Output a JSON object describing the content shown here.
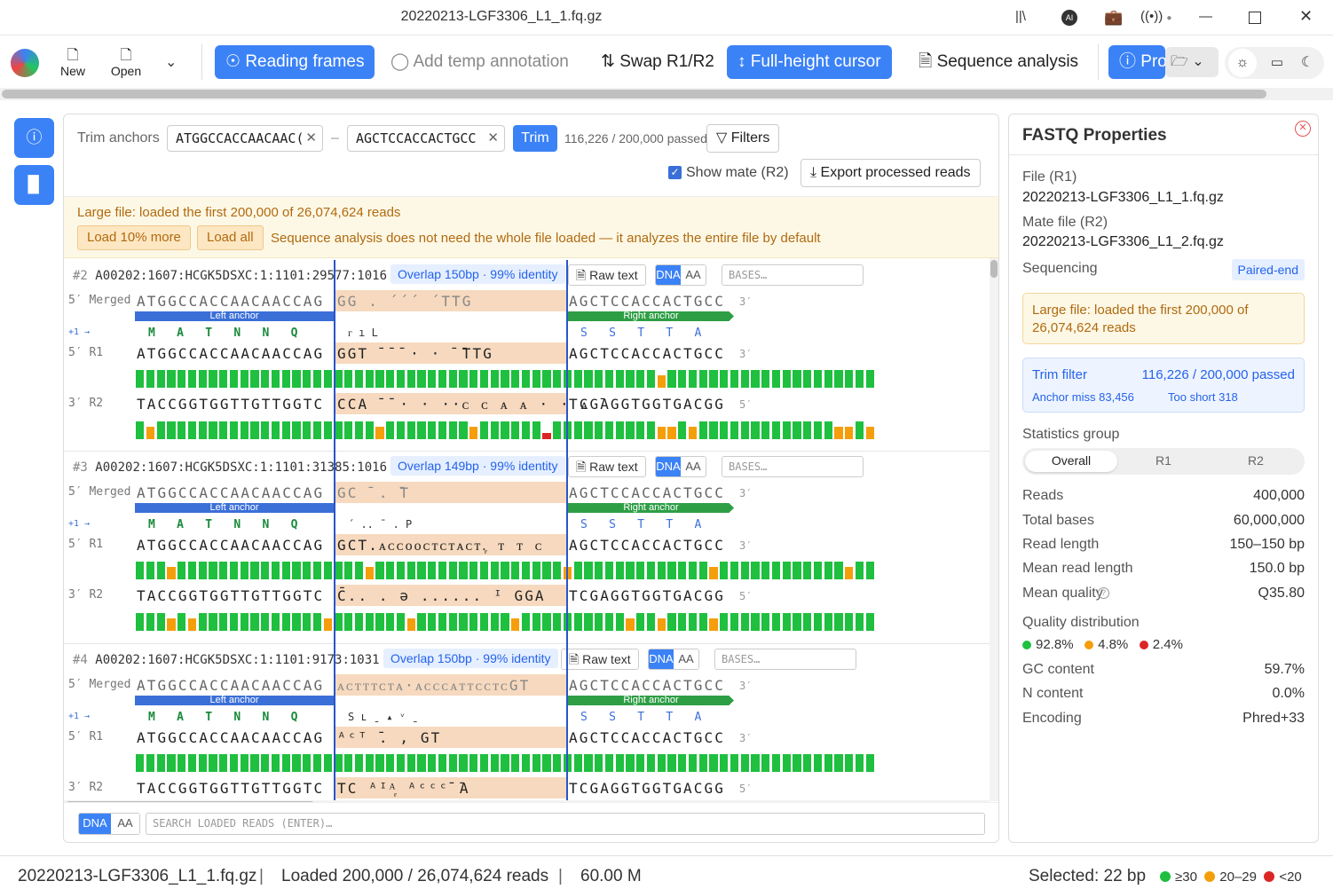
{
  "window": {
    "title": "20220213-LGF3306_L1_1.fq.gz"
  },
  "toolbar": {
    "new": "New",
    "open": "Open",
    "reading_frames": "Reading frames",
    "add_temp_annotation": "Add temp annotation",
    "swap": "Swap R1/R2",
    "full_height_cursor": "Full-height cursor",
    "sequence_analysis": "Sequence analysis",
    "pro": "Pro"
  },
  "trim": {
    "label": "Trim anchors",
    "left_anchor": "ATGGCCACCAACAAC(",
    "dash": "–",
    "right_anchor": "AGCTCCACCACTGCC",
    "trim_button": "Trim",
    "passed": "116,226 / 200,000 passed",
    "filters": "Filters",
    "show_mate": "Show mate (R2)",
    "export": "Export processed reads"
  },
  "banner": {
    "message": "Large file: loaded the first 200,000 of 26,074,624 reads",
    "load_more": "Load 10% more",
    "load_all": "Load all",
    "note": "Sequence analysis does not need the whole file loaded — it analyzes the entire file by default"
  },
  "labels": {
    "merged": "5′ Merged",
    "r1": "5′ R1",
    "r2": "3′ R2",
    "frame": "+1 →",
    "end3": "3′",
    "end5": "5′",
    "left_anchor": "Left anchor",
    "right_anchor": "Right anchor",
    "raw_text": "Raw text",
    "dna": "DNA",
    "aa": "AA",
    "bases_placeholder": "BASES…"
  },
  "reads": [
    {
      "num": "#2",
      "id": "A00202:1607:HCGK5DSXC:1:1101:29577:1016",
      "overlap": "Overlap 150bp · 99% identity",
      "merged_left": "ATGGCCACCAACAACCAG",
      "merged_mid": "GG . ´´´ ´TTG",
      "merged_right": "AGCTCCACCACTGCC",
      "aa_left": "MATNNQ",
      "aa_mid": "ᴦ                           ı  L",
      "aa_right": "SSTTA",
      "r1_left": "ATGGCCACCAACAACCAG",
      "r1_mid": "GGT ̄ ̄ ̄  · ·   ̄ ̄TTG",
      "r1_right": "AGCTCCACCACTGCC",
      "r2_left": "TACCGGTGGTTGTTGGTC",
      "r2_mid": "CCA ̄ ̄ · · ··ᴄ ᴄ ᴀ ᴀ ·  · ᴀ ̄",
      "r2_right": "TCGAGGTGGTGACGG",
      "q1": "ggggggggggggggggggggggggggggggggggggggggggggggggggogggggggggggggggggggggggggggggg",
      "q2": "gogggggggggggggggggggggoggggggggoggggggrggggggggggoogogggggggggggggoogogggogggggggg"
    },
    {
      "num": "#3",
      "id": "A00202:1607:HCGK5DSXC:1:1101:31385:1016",
      "overlap": "Overlap 149bp · 99% identity",
      "merged_left": "ATGGCCACCAACAACCAG",
      "merged_mid": "GC ̄ .                          ̄T",
      "merged_right": "AGCTCCACCACTGCC",
      "aa_left": "MATNNQ",
      "aa_mid": "´          ..       ¯      .   P",
      "aa_right": "SSTTA",
      "r1_left": "ATGGCCACCAACAACCAG",
      "r1_mid": "GCT.ᴀᴄᴄᴏᴏᴄᴛᴄᴛᴀᴄᴛ.᷊ ᴛ ᴛ ᴄ",
      "r1_right": "AGCTCCACCACTGCC",
      "r2_left": "TACCGGTGGTTGTTGGTC",
      "r2_mid": "C̄.. .     ǝ      ...... ᴵ GGA",
      "r2_right": "TCGAGGTGGTGACGG",
      "q1": "gggoggggggggggggggggggoggggggggggggggggggogggggggggggggoggggggggggggogggggggggggggg",
      "q2": "gggogoggggggggggggogggggggogggggggggoggggggggggoggoggggogggggggggggggggggggggggggg"
    },
    {
      "num": "#4",
      "id": "A00202:1607:HCGK5DSXC:1:1101:9173:1031",
      "overlap": "Overlap 150bp · 99% identity",
      "merged_left": "ATGGCCACCAACAACCAG",
      "merged_mid": "ᴀᴄᴛᴛᴛᴄᴛᴀ·ᴀᴄᴄᴄᴀᴛᴛᴄᴄᴛᴄGT",
      "merged_right": "AGCTCCACCACTGCC",
      "aa_left": "MATNNQ",
      "aa_mid": "S    ʟ          ˍ   ▴  ᵛ  ˍ",
      "aa_right": "SSTTA",
      "r1_left": "ATGGCCACCAACAACCAG",
      "r1_mid": "ᴬᶜᵀ ̄.                   , GT",
      "r1_right": "AGCTCCACCACTGCC",
      "r2_left": "TACCGGTGGTTGTTGGTC",
      "r2_mid": "TC    ᴬᴵᴬ᷊          ᴬᶜᶜᶜ̄  ̄A",
      "r2_right": "TCGAGGTGGTGACGG",
      "q1": "ggggggggggggggggggggggggggggggggggggggggggggggggggggggggggggggggggggggggggggggggggg",
      "q2": ""
    }
  ],
  "search": {
    "dna": "DNA",
    "aa": "AA",
    "placeholder": "SEARCH LOADED READS (ENTER)…"
  },
  "properties": {
    "title": "FASTQ Properties",
    "file_label": "File (R1)",
    "file": "20220213-LGF3306_L1_1.fq.gz",
    "mate_label": "Mate file (R2)",
    "mate": "20220213-LGF3306_L1_2.fq.gz",
    "sequencing_label": "Sequencing",
    "sequencing": "Paired-end",
    "large_file": "Large file: loaded the first 200,000 of 26,074,624 reads",
    "trim_filter_label": "Trim filter",
    "trim_filter": "116,226 / 200,000 passed",
    "anchor_miss": "Anchor miss 83,456",
    "too_short": "Too short 318",
    "stats_group_label": "Statistics group",
    "tabs": [
      "Overall",
      "R1",
      "R2"
    ],
    "stats": [
      {
        "label": "Reads",
        "value": "400,000"
      },
      {
        "label": "Total bases",
        "value": "60,000,000"
      },
      {
        "label": "Read length",
        "value": "150–150 bp"
      },
      {
        "label": "Mean read length",
        "value": "150.0 bp"
      },
      {
        "label": "Mean quality",
        "value": "Q35.80"
      }
    ],
    "quality_distribution_label": "Quality distribution",
    "quality_distribution": [
      {
        "value": "92.8%",
        "color": "#1fbf3f"
      },
      {
        "value": "4.8%",
        "color": "#f59e0b"
      },
      {
        "value": "2.4%",
        "color": "#dc2626"
      }
    ],
    "stats2": [
      {
        "label": "GC content",
        "value": "59.7%"
      },
      {
        "label": "N content",
        "value": "0.0%"
      },
      {
        "label": "Encoding",
        "value": "Phred+33"
      }
    ]
  },
  "status": {
    "file": "20220213-LGF3306_L1_1.fq.gz",
    "loaded": "Loaded 200,000 / 26,074,624 reads",
    "size": "60.00 M",
    "selected": "Selected: 22 bp",
    "legend": [
      {
        "label": "≥30",
        "color": "#1fbf3f"
      },
      {
        "label": "20–29",
        "color": "#f59e0b"
      },
      {
        "label": "<20",
        "color": "#dc2626"
      }
    ]
  }
}
